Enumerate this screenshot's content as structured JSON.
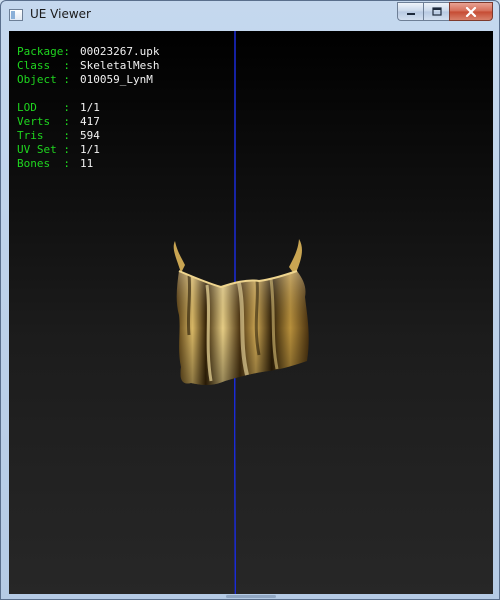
{
  "window": {
    "title": "UE Viewer",
    "buttons": {
      "minimize": "minimize-icon",
      "maximize": "maximize-icon",
      "close": "close-icon"
    }
  },
  "info": {
    "package_label": "Package:",
    "package_value": "00023267.upk",
    "class_label": "Class  :",
    "class_value": "SkeletalMesh",
    "object_label": "Object :",
    "object_value": "010059_LynM",
    "lod_label": "LOD    :",
    "lod_value": "1/1",
    "verts_label": "Verts  :",
    "verts_value": "417",
    "tris_label": "Tris   :",
    "tris_value": "594",
    "uvset_label": "UV Set :",
    "uvset_value": "1/1",
    "bones_label": "Bones  :",
    "bones_value": "11"
  },
  "colors": {
    "label": "#1fd61f",
    "value": "#f2f2f2",
    "axis": "#1a2bd8",
    "mesh": "#b8903c"
  }
}
